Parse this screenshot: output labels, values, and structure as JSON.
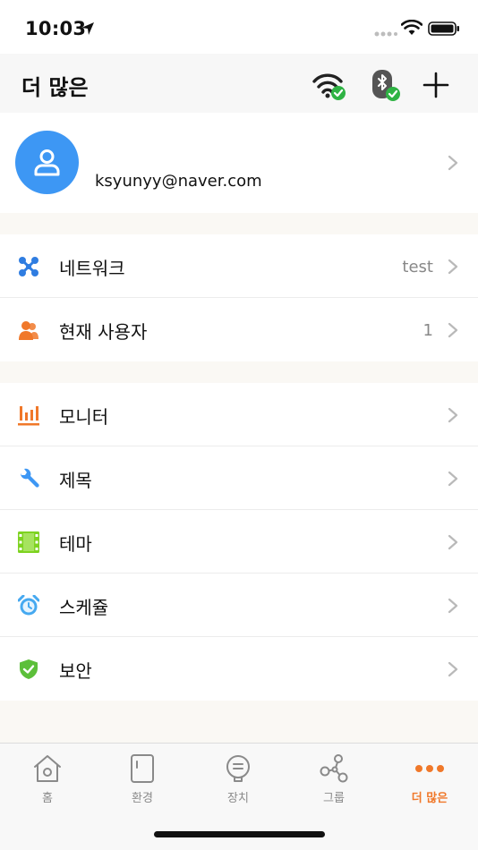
{
  "status_bar": {
    "time": "10:03"
  },
  "nav": {
    "title": "더 많은"
  },
  "profile": {
    "email": "ksyunyy@naver.com"
  },
  "group1": [
    {
      "label": "네트워크",
      "value": "test",
      "icon": "network-icon",
      "icon_color": "#2f7de1"
    },
    {
      "label": "현재 사용자",
      "value": "1",
      "icon": "users-icon",
      "icon_color": "#f0782a"
    }
  ],
  "group2": [
    {
      "label": "모니터",
      "value": "",
      "icon": "monitor-chart-icon",
      "icon_color": "#f0782a"
    },
    {
      "label": "제목",
      "value": "",
      "icon": "wrench-icon",
      "icon_color": "#3d97f4"
    },
    {
      "label": "테마",
      "value": "",
      "icon": "film-icon",
      "icon_color": "#7ed321"
    },
    {
      "label": "스케쥴",
      "value": "",
      "icon": "alarm-clock-icon",
      "icon_color": "#46a9f0"
    },
    {
      "label": "보안",
      "value": "",
      "icon": "shield-check-icon",
      "icon_color": "#5cbf3a"
    }
  ],
  "tabs": [
    {
      "label": "홈",
      "icon": "home-icon",
      "active": false
    },
    {
      "label": "환경",
      "icon": "fridge-icon",
      "active": false
    },
    {
      "label": "장치",
      "icon": "device-icon",
      "active": false
    },
    {
      "label": "그룹",
      "icon": "group-share-icon",
      "active": false
    },
    {
      "label": "더 많은",
      "icon": "more-dots-icon",
      "active": true
    }
  ],
  "colors": {
    "accent": "#f0782a",
    "avatar_bg": "#3d97f4",
    "check_green": "#2fb344"
  }
}
